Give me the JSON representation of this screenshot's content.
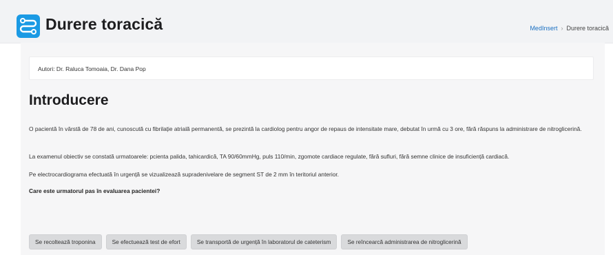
{
  "header": {
    "title": "Durere toracică",
    "logo_icon": "route-icon",
    "accent_color": "#1b9ae4"
  },
  "breadcrumb": {
    "items": [
      "MedInsert",
      "Durere toracică"
    ]
  },
  "authors": "Autori: Dr. Raluca Tomoaia, Dr. Dana Pop",
  "section": {
    "title": "Introducere",
    "paragraphs": [
      "O pacientă în vârstă de 78 de ani, cunoscută cu fibrilație atrială permanentă, se prezintă la cardiolog pentru angor de repaus de intensitate mare, debutat în urmă cu 3 ore, fără răspuns la administrare de nitroglicerină.",
      "La examenul obiectiv se constată urmatoarele: pcienta palida, tahicardică, TA 90/60mmHg, puls 110/min, zgomote cardiace regulate, fără sufluri, fără semne clinice de insuficiență cardiacă.",
      "Pe electrocardiograma efectuată în urgență se vizualizează supradenivelare de segment ST de 2 mm în teritoriul anterior."
    ],
    "question": "Care este urmatorul pas în evaluarea pacientei?"
  },
  "options": [
    "Se recoltează troponina",
    "Se efectuează test de efort",
    "Se transportă de urgență în laboratorul de cateterism",
    "Se reîncearcă administrarea de nitroglicerină"
  ]
}
